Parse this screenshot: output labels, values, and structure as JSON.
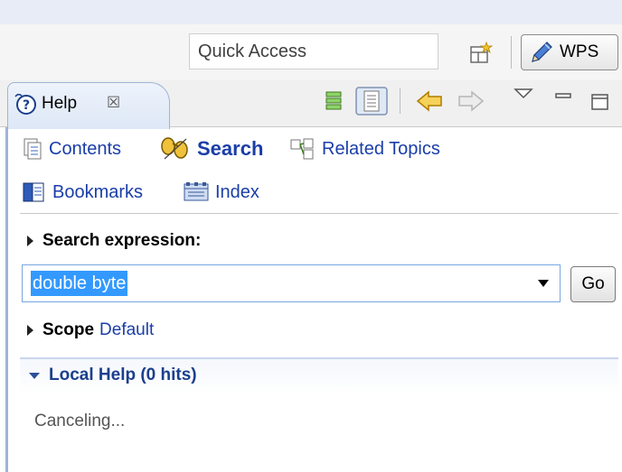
{
  "toolbar": {
    "quick_access_placeholder": "Quick Access",
    "perspective_label": "WPS"
  },
  "view": {
    "tab_label": "Help",
    "tab_close_glyph": "☒"
  },
  "nav": {
    "contents": "Contents",
    "search": "Search",
    "related_topics": "Related Topics",
    "bookmarks": "Bookmarks",
    "index": "Index"
  },
  "search": {
    "section_label": "Search expression:",
    "value": "double byte",
    "go_label": "Go"
  },
  "scope": {
    "label": "Scope",
    "value": "Default"
  },
  "results": {
    "header": "Local Help (0 hits)",
    "status": "Canceling..."
  },
  "colors": {
    "link": "#1a3ea8",
    "selection": "#3399ff",
    "tab_border": "#9fb4d4"
  }
}
